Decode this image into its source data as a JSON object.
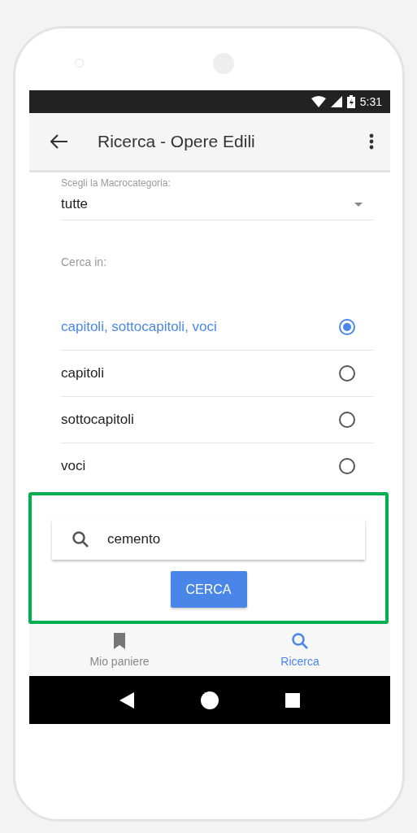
{
  "status_bar": {
    "time": "5:31"
  },
  "app_bar": {
    "title": "Ricerca - Opere Edili"
  },
  "macrocategory": {
    "label": "Scegli la Macrocategoria:",
    "value": "tutte"
  },
  "search_in": {
    "label": "Cerca in:",
    "options": [
      {
        "label": "capitoli, sottocapitoli, voci",
        "selected": true
      },
      {
        "label": "capitoli",
        "selected": false
      },
      {
        "label": "sottocapitoli",
        "selected": false
      },
      {
        "label": "voci",
        "selected": false
      }
    ]
  },
  "search": {
    "value": "cemento",
    "button": "CERCA"
  },
  "bottom_nav": [
    {
      "label": "Mio paniere",
      "kind": "bookmark",
      "selected": false
    },
    {
      "label": "Ricerca",
      "kind": "search",
      "selected": true
    }
  ]
}
